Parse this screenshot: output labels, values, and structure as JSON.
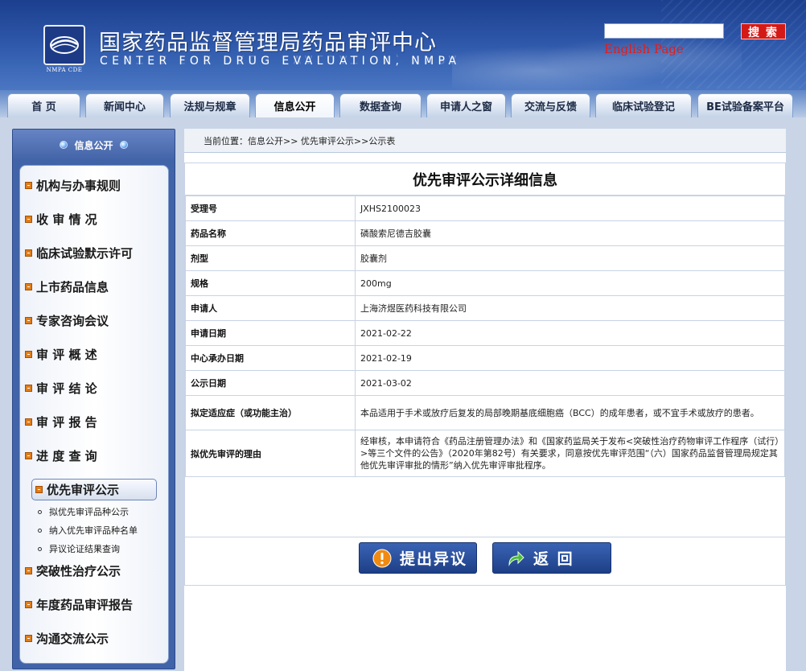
{
  "header": {
    "title": "国家药品监督管理局药品审评中心",
    "subtitle": "CENTER FOR DRUG EVALUATION, NMPA",
    "logo_caption": "NMPA CDE",
    "search_value": "",
    "search_button": "搜 索",
    "english_link": "English Page"
  },
  "nav": {
    "tabs": [
      {
        "label": "首  页"
      },
      {
        "label": "新闻中心"
      },
      {
        "label": "法规与规章"
      },
      {
        "label": "信息公开"
      },
      {
        "label": "数据查询"
      },
      {
        "label": "申请人之窗"
      },
      {
        "label": "交流与反馈"
      },
      {
        "label": "临床试验登记"
      },
      {
        "label": "BE试验备案平台"
      }
    ],
    "active_index": 3
  },
  "sidebar": {
    "title": "信息公开",
    "items": [
      {
        "label": "机构与办事规则"
      },
      {
        "label": "收 审 情 况"
      },
      {
        "label": "临床试验默示许可"
      },
      {
        "label": "上市药品信息"
      },
      {
        "label": "专家咨询会议"
      },
      {
        "label": "审 评 概 述"
      },
      {
        "label": "审 评 结 论"
      },
      {
        "label": "审 评 报 告"
      },
      {
        "label": "进 度 查 询"
      },
      {
        "label": "优先审评公示"
      },
      {
        "label": "突破性治疗公示"
      },
      {
        "label": "年度药品审评报告"
      },
      {
        "label": "沟通交流公示"
      }
    ],
    "sub_items": [
      {
        "label": "拟优先审评品种公示"
      },
      {
        "label": "纳入优先审评品种名单"
      },
      {
        "label": "异议论证结果查询"
      }
    ]
  },
  "breadcrumb": "当前位置：信息公开>> 优先审评公示>>公示表",
  "detail": {
    "title": "优先审评公示详细信息",
    "rows": [
      {
        "key": "受理号",
        "value": "JXHS2100023"
      },
      {
        "key": "药品名称",
        "value": "磷酸索尼德吉胶囊"
      },
      {
        "key": "剂型",
        "value": "胶囊剂"
      },
      {
        "key": "规格",
        "value": "200mg"
      },
      {
        "key": "申请人",
        "value": "上海济煜医药科技有限公司"
      },
      {
        "key": "申请日期",
        "value": "2021-02-22"
      },
      {
        "key": "中心承办日期",
        "value": "2021-02-19"
      },
      {
        "key": "公示日期",
        "value": "2021-03-02"
      },
      {
        "key": "拟定适应症（或功能主治）",
        "value": "本品适用于手术或放疗后复发的局部晚期基底细胞癌（BCC）的成年患者，或不宜手术或放疗的患者。"
      },
      {
        "key": "拟优先审评的理由",
        "value": "经审核，本申请符合《药品注册管理办法》和《国家药监局关于发布<突破性治疗药物审评工作程序（试行）>等三个文件的公告》（2020年第82号）有关要求，同意按优先审评范围“（六）国家药品监督管理局规定其他优先审评审批的情形”纳入优先审评审批程序。"
      }
    ]
  },
  "buttons": {
    "objection": "提出异议",
    "back": "返  回"
  },
  "colors": {
    "header_blue": "#2d56a8",
    "search_red": "#d41a16",
    "english_red": "#e31c1c",
    "button_blue": "#1d3f86",
    "bullet_orange": "#e07d1a"
  }
}
